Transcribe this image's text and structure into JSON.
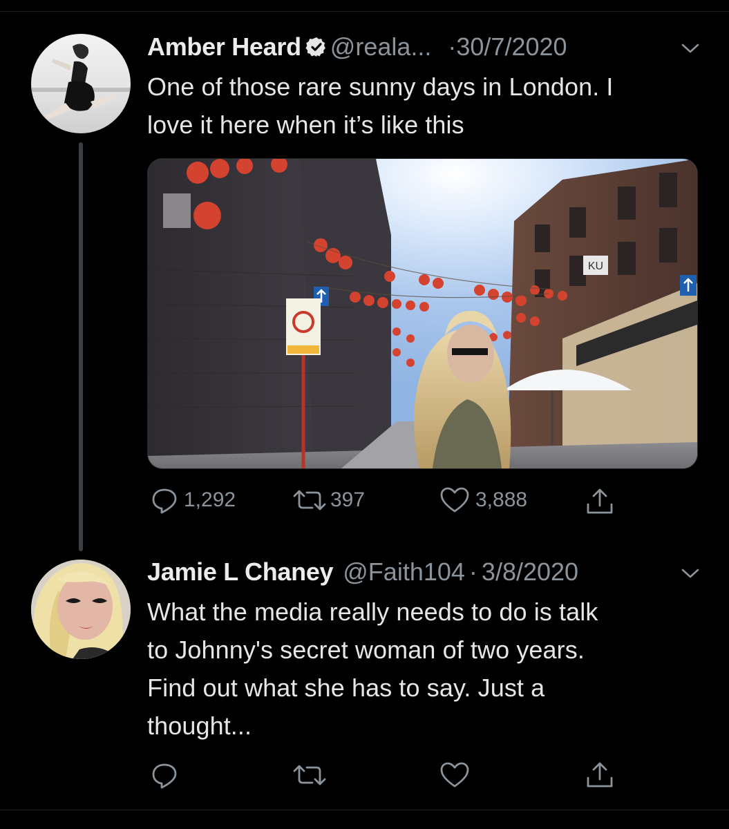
{
  "colors": {
    "background": "#000000",
    "text_primary": "#e6e6e6",
    "text_secondary": "#8b949b",
    "thread_line": "#3a3f44"
  },
  "tweet1": {
    "name": "Amber Heard",
    "verified": true,
    "handle": "@reala...",
    "separator": "·",
    "date": "30/7/2020",
    "text_line1": "One of those rare sunny days in London. I",
    "text_line2": "love it here when it’s like this",
    "media_description": "street-photo-with-red-lanterns",
    "actions": {
      "replies": "1,292",
      "retweets": "397",
      "likes": "3,888"
    },
    "icons": [
      "reply-icon",
      "retweet-icon",
      "like-icon",
      "share-icon"
    ]
  },
  "tweet2": {
    "name": "Jamie L Chaney",
    "handle": "@Faith104",
    "separator": "·",
    "date": "3/8/2020",
    "text_lines": [
      "What the media really needs to do is talk",
      "to Johnny's secret woman of two years.",
      "Find out what she has to say. Just a",
      "thought..."
    ],
    "icons": [
      "reply-icon",
      "retweet-icon",
      "like-icon",
      "share-icon"
    ]
  }
}
